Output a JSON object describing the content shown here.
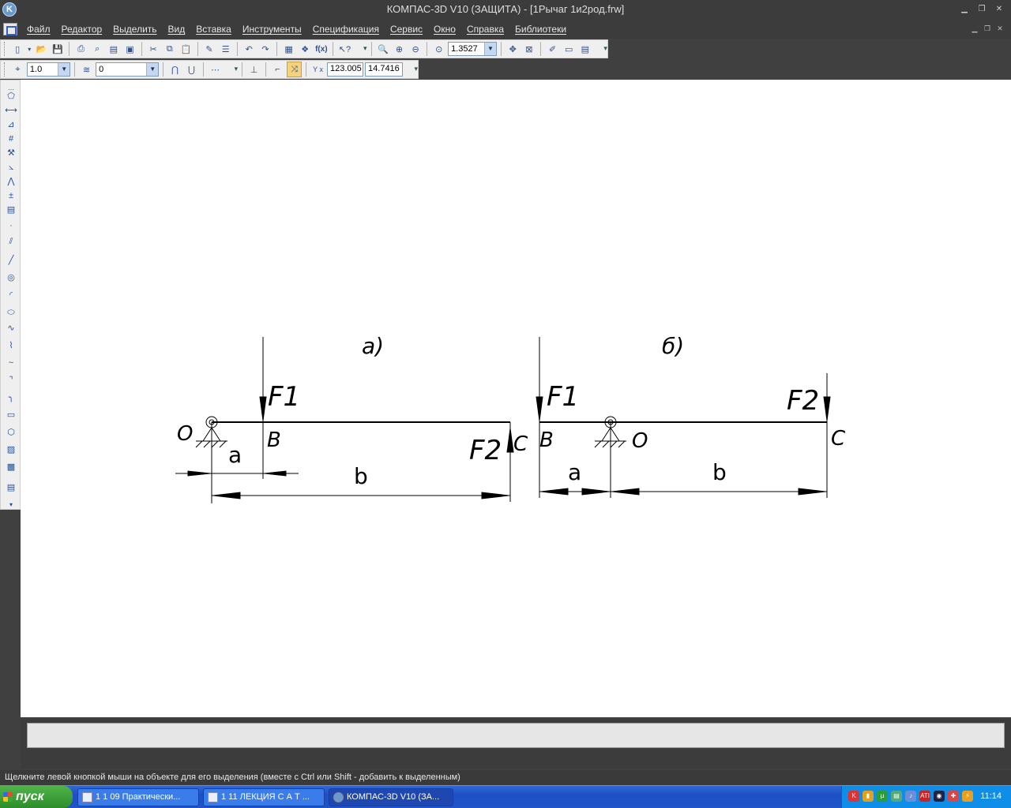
{
  "window": {
    "title": "КОМПАС-3D V10 (ЗАЩИТА) - [1Рычаг 1и2род.frw]",
    "app_icon_letter": "K"
  },
  "menu": {
    "items": [
      "Файл",
      "Редактор",
      "Выделить",
      "Вид",
      "Вставка",
      "Инструменты",
      "Спецификация",
      "Сервис",
      "Окно",
      "Справка",
      "Библиотеки"
    ]
  },
  "toolbar": {
    "zoom_value": "1.3527",
    "fx_label": "f(x)"
  },
  "current_state": {
    "step_value": "1.0",
    "layer_value": "0",
    "x_coord": "123.005",
    "y_coord": "14.7416",
    "coord_label": "Y x"
  },
  "drawing": {
    "fig_a_label": "а)",
    "fig_b_label": "б)",
    "a": {
      "point_o": "O",
      "point_b": "B",
      "point_c": "C",
      "force_1": "F1",
      "force_2": "F2",
      "dim_a": "a",
      "dim_b": "b"
    },
    "b": {
      "point_b": "B",
      "point_o": "O",
      "point_c": "C",
      "force_1": "F1",
      "force_2": "F2",
      "dim_a": "a",
      "dim_b": "b"
    }
  },
  "status": {
    "hint": "Щелкните левой кнопкой мыши на объекте для его выделения (вместе с Ctrl или Shift - добавить к выделенным)"
  },
  "taskbar": {
    "start_label": "пуск",
    "tasks": [
      "1 1 09 Практически...",
      "1 11 ЛЕКЦИЯ С А Т ...",
      "КОМПАС-3D V10 (ЗА..."
    ],
    "clock": "11:14"
  },
  "colors": {
    "title_bg": "#3c3c3c",
    "toolbar_bg": "#efefef",
    "taskbar_blue": "#245edb",
    "start_green": "#3c9b37"
  }
}
